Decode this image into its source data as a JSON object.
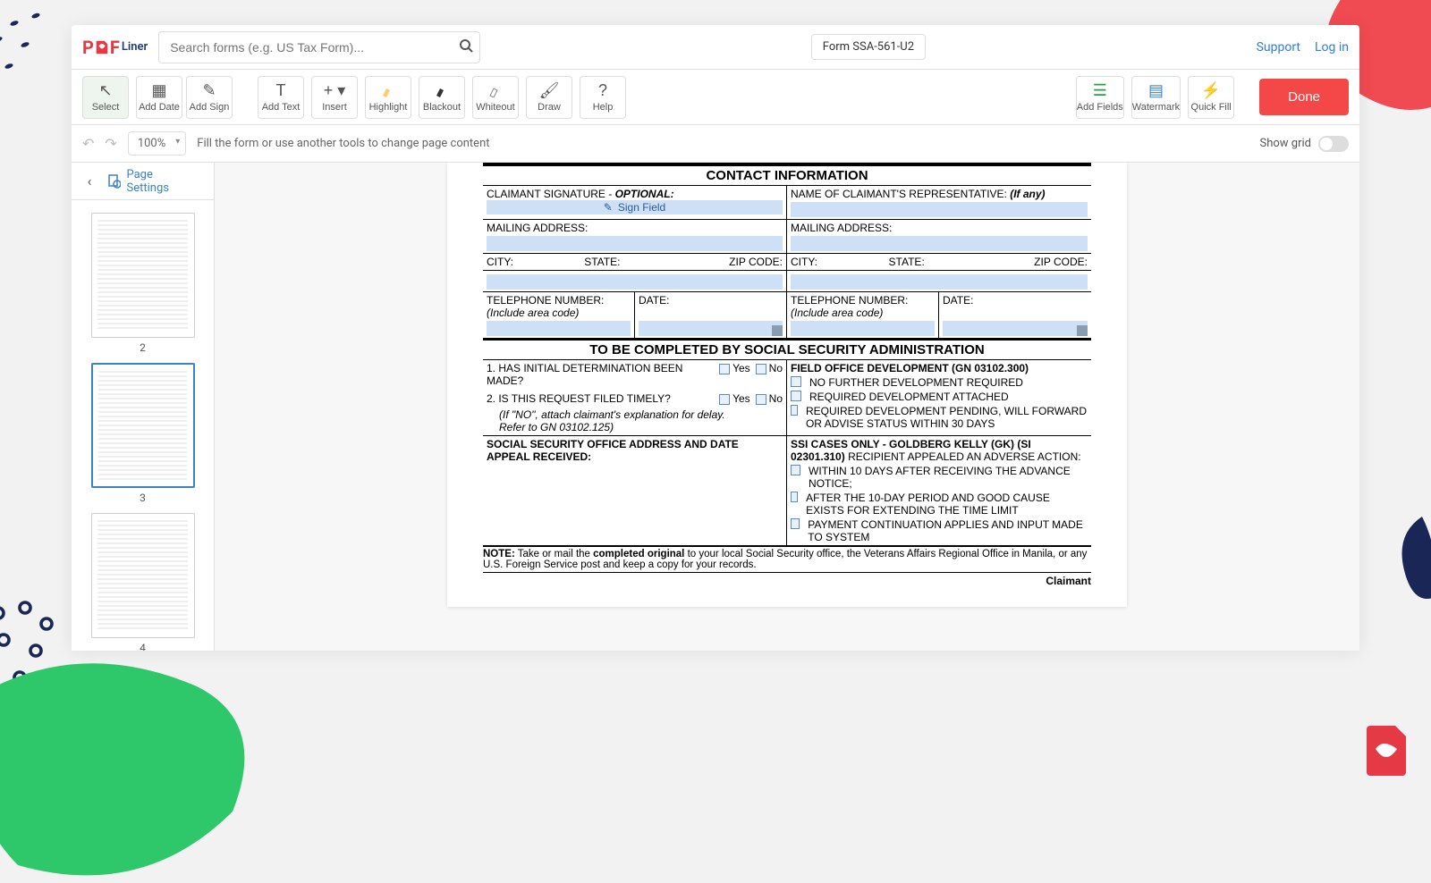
{
  "header": {
    "logo_part1": "P",
    "logo_part2": "D",
    "logo_part3": "F",
    "logo_suffix": "Liner",
    "search_placeholder": "Search forms (e.g. US Tax Form)...",
    "form_title": "Form SSA-561-U2",
    "support_link": "Support",
    "login_link": "Log in"
  },
  "toolbar": {
    "select": "Select",
    "add_date": "Add Date",
    "add_sign": "Add Sign",
    "add_text": "Add Text",
    "insert": "Insert",
    "highlight": "Highlight",
    "blackout": "Blackout",
    "whiteout": "Whiteout",
    "draw": "Draw",
    "help": "Help",
    "add_fields": "Add Fields",
    "watermark": "Watermark",
    "quick_fill": "Quick Fill",
    "done": "Done"
  },
  "subbar": {
    "zoom": "100%",
    "hint": "Fill the form or use another tools to change page content",
    "show_grid": "Show grid"
  },
  "sidebar": {
    "page_settings": "Page Settings",
    "thumbs": [
      {
        "num": "2",
        "selected": false
      },
      {
        "num": "3",
        "selected": true
      },
      {
        "num": "4",
        "selected": false
      }
    ]
  },
  "form": {
    "section_contact": "CONTACT INFORMATION",
    "claimant_sig": "CLAIMANT SIGNATURE - ",
    "optional": "OPTIONAL:",
    "sign_field": "Sign Field",
    "rep_name": "NAME OF CLAIMANT'S REPRESENTATIVE: ",
    "if_any": "(If any)",
    "mailing_addr": "MAILING ADDRESS:",
    "city": "CITY:",
    "state": "STATE:",
    "zip": "ZIP CODE:",
    "tel": "TELEPHONE NUMBER:",
    "area_code": "(Include area code)",
    "date": "DATE:",
    "section_ssa": "TO BE COMPLETED BY SOCIAL SECURITY ADMINISTRATION",
    "q1": "1. HAS INITIAL DETERMINATION BEEN MADE?",
    "q2": "2. IS THIS REQUEST FILED TIMELY?",
    "yes": "Yes",
    "no": "No",
    "q2_note1": "(If \"NO\", attach claimant's explanation for delay.",
    "q2_note2": "Refer to GN 03102.125)",
    "office_addr": "SOCIAL SECURITY OFFICE ADDRESS AND DATE APPEAL RECEIVED:",
    "fod": "FIELD OFFICE DEVELOPMENT (GN 03102.300)",
    "fod_a": "NO FURTHER DEVELOPMENT REQUIRED",
    "fod_b": "REQUIRED DEVELOPMENT ATTACHED",
    "fod_c": "REQUIRED DEVELOPMENT PENDING, WILL FORWARD OR ADVISE STATUS WITHIN 30 DAYS",
    "ssi_head": "SSI CASES ONLY - GOLDBERG KELLY (GK) (SI 02301.310)",
    "ssi_head2": " RECIPIENT APPEALED AN ADVERSE ACTION:",
    "ssi_a": "WITHIN 10 DAYS AFTER RECEIVING THE ADVANCE NOTICE;",
    "ssi_b": "AFTER THE 10-DAY PERIOD AND GOOD CAUSE EXISTS FOR EXTENDING THE TIME LIMIT",
    "ssi_c": "PAYMENT CONTINUATION APPLIES AND INPUT MADE TO SYSTEM",
    "note_bold": "NOTE:",
    "note_text1": " Take or mail the ",
    "note_bold2": "completed original",
    "note_text2": " to your local Social Security office, the Veterans Affairs Regional Office in Manila, or any U.S. Foreign Service post and keep a copy for your records.",
    "claimant": "Claimant"
  }
}
